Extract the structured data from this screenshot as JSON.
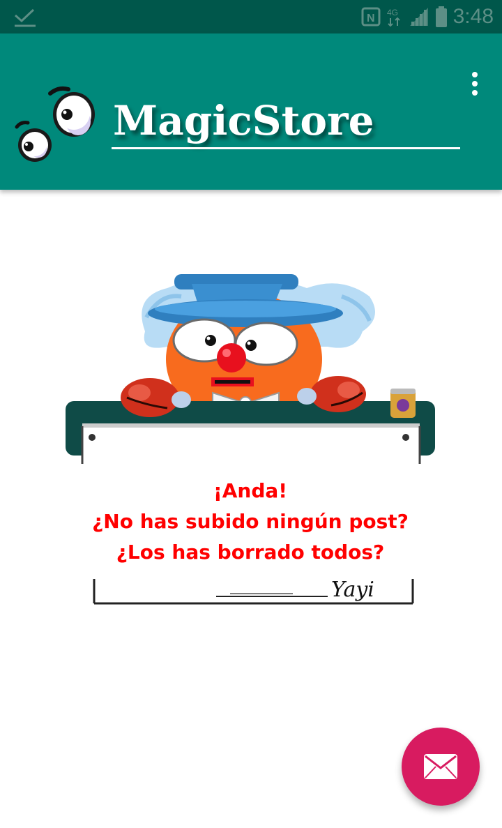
{
  "status_bar": {
    "time": "3:48",
    "icons": [
      "check-icon",
      "nfc-icon",
      "lte-icon",
      "signal-icon",
      "battery-icon"
    ],
    "network_label": "4G"
  },
  "app_bar": {
    "title": "MagicStore",
    "logo": "eyes-logo",
    "menu_icon": "more-vert-icon",
    "colors": {
      "primary": "#00897b",
      "primary_dark": "#00574b",
      "title": "#ffffff"
    }
  },
  "empty_state": {
    "illustration": "clown-holding-sign",
    "lines": [
      "¡Anda!",
      "¿No has subido ningún post?",
      "¿Los has borrado todos?"
    ],
    "signature": "Yayi",
    "text_color": "#ff0000"
  },
  "fab": {
    "icon": "mail-icon",
    "color": "#d81b60"
  }
}
